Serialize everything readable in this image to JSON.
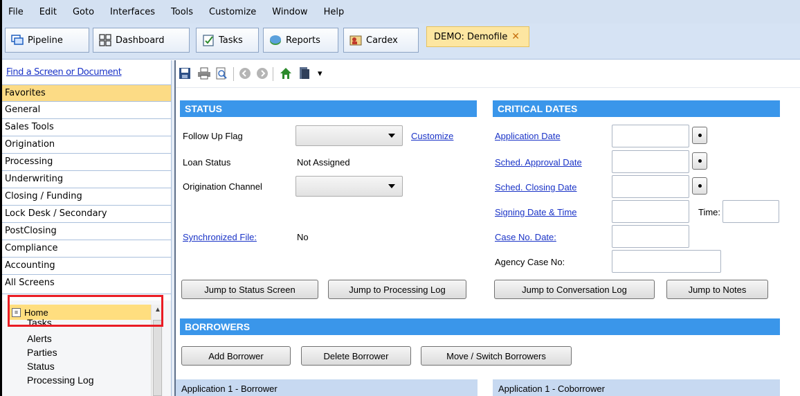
{
  "menu": [
    "File",
    "Edit",
    "Goto",
    "Interfaces",
    "Tools",
    "Customize",
    "Window",
    "Help"
  ],
  "toolbar": {
    "pipeline": "Pipeline",
    "dashboard": "Dashboard",
    "tasks": "Tasks",
    "reports": "Reports",
    "cardex": "Cardex",
    "file_tab": "DEMO: Demofile",
    "close": "✕"
  },
  "sidebar": {
    "find": "Find a Screen or Document",
    "categories": [
      "Favorites",
      "General",
      "Sales Tools",
      "Origination",
      "Processing",
      "Underwriting",
      "Closing / Funding",
      "Lock Desk / Secondary",
      "PostClosing",
      "Compliance",
      "Accounting",
      "All Screens"
    ],
    "home": "Home",
    "sub_items": [
      "Tasks",
      "Alerts",
      "Parties",
      "Status",
      "Processing Log"
    ]
  },
  "status": {
    "header": "STATUS",
    "follow_up_label": "Follow Up Flag",
    "customize": "Customize",
    "loan_status_label": "Loan Status",
    "loan_status_value": "Not Assigned",
    "channel_label": "Origination Channel",
    "sync_label": "Synchronized File:",
    "sync_value": "No",
    "jump_status": "Jump to Status Screen",
    "jump_processing": "Jump to Processing Log"
  },
  "critical": {
    "header": "CRITICAL DATES",
    "application_date": "Application Date",
    "sched_approval": "Sched. Approval Date",
    "sched_closing": "Sched. Closing Date",
    "signing": "Signing Date & Time",
    "time_label": "Time:",
    "case_no_date": "Case No. Date:",
    "agency_case": "Agency Case No:",
    "jump_conversation": "Jump to Conversation Log",
    "jump_notes": "Jump to Notes"
  },
  "borrowers": {
    "header": "BORROWERS",
    "add": "Add Borrower",
    "delete": "Delete Borrower",
    "move": "Move / Switch Borrowers",
    "app1_borrower": "Application 1 - Borrower",
    "app1_coborrower": "Application 1 - Coborrower"
  }
}
